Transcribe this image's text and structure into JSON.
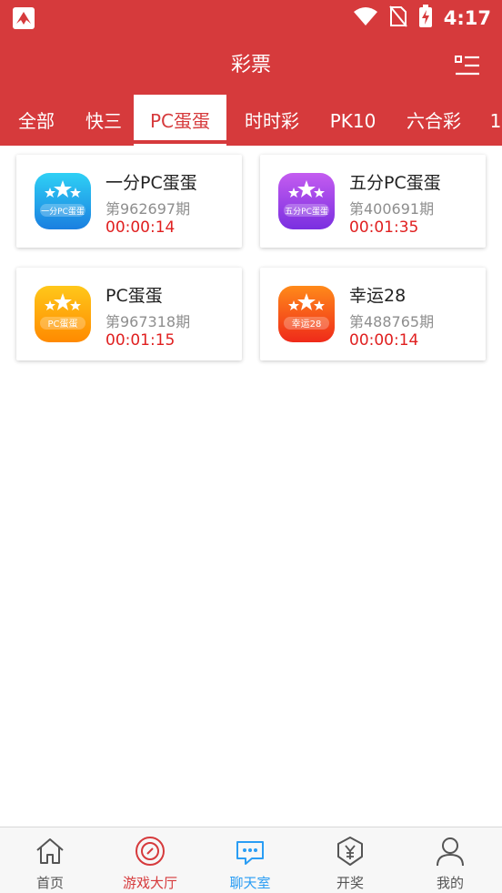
{
  "status_bar": {
    "time": "4:17",
    "icons": [
      "app-logo-icon",
      "wifi-icon",
      "no-sim-icon",
      "battery-charging-icon"
    ]
  },
  "header": {
    "title": "彩票",
    "menu_icon": "list-menu-icon"
  },
  "tabs": [
    {
      "label": "全部",
      "active": false
    },
    {
      "label": "快三",
      "active": false
    },
    {
      "label": "PC蛋蛋",
      "active": true
    },
    {
      "label": "时时彩",
      "active": false
    },
    {
      "label": "PK10",
      "active": false
    },
    {
      "label": "六合彩",
      "active": false
    },
    {
      "label": "1",
      "active": false
    }
  ],
  "games": [
    {
      "name": "一分PC蛋蛋",
      "period": "第962697期",
      "countdown": "00:00:14",
      "icon_text": "一分PC蛋蛋",
      "icon_colors": [
        "#2fd0f5",
        "#1a7fe0"
      ]
    },
    {
      "name": "五分PC蛋蛋",
      "period": "第400691期",
      "countdown": "00:01:35",
      "icon_text": "五分PC蛋蛋",
      "icon_colors": [
        "#c45cf0",
        "#7a2fe0"
      ]
    },
    {
      "name": "PC蛋蛋",
      "period": "第967318期",
      "countdown": "00:01:15",
      "icon_text": "PC蛋蛋",
      "icon_colors": [
        "#ffc81a",
        "#ff8a00"
      ]
    },
    {
      "name": "幸运28",
      "period": "第488765期",
      "countdown": "00:00:14",
      "icon_text": "幸运28",
      "icon_colors": [
        "#ff8a1a",
        "#ef2a1a"
      ]
    }
  ],
  "bottom_nav": [
    {
      "label": "首页",
      "icon": "home-icon",
      "color": "#555555"
    },
    {
      "label": "游戏大厅",
      "icon": "game-hall-icon",
      "color": "#d63a3c"
    },
    {
      "label": "聊天室",
      "icon": "chat-icon",
      "color": "#2a9df4"
    },
    {
      "label": "开奖",
      "icon": "lottery-draw-icon",
      "color": "#555555"
    },
    {
      "label": "我的",
      "icon": "profile-icon",
      "color": "#555555"
    }
  ],
  "colors": {
    "brand": "#d63a3c",
    "countdown": "#e02020"
  }
}
